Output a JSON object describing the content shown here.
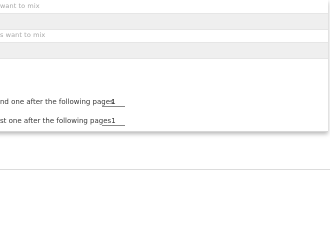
{
  "fields": [
    {
      "placeholder": "want to mix"
    },
    {
      "placeholder": "s want to mix"
    }
  ],
  "options": [
    {
      "label": "nd one after the following pages",
      "value": "1"
    },
    {
      "label": "st one after the following pages",
      "value": "1"
    }
  ]
}
